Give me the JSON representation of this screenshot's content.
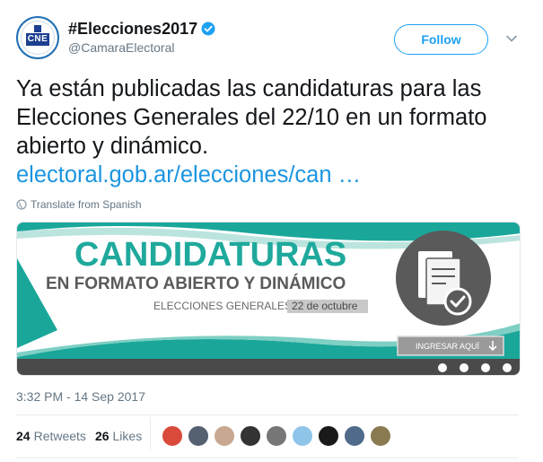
{
  "header": {
    "display_name": "#Elecciones2017",
    "handle": "@CamaraElectoral",
    "avatar_text": "CNE",
    "follow_label": "Follow"
  },
  "tweet": {
    "text": "Ya están publicadas las candidaturas para las Elecciones Generales del 22/10 en un formato abierto y dinámico.",
    "link": "electoral.gob.ar/elecciones/can …",
    "translate_label": "Translate from Spanish"
  },
  "card": {
    "title": "CANDIDATURAS",
    "subtitle": "EN FORMATO ABIERTO Y DINÁMICO",
    "elections_label": "ELECCIONES GENERALES",
    "date_label": "22 de octubre",
    "button_label": "INGRESAR AQUÍ",
    "colors": {
      "teal": "#1aa79a",
      "dark_bar": "#4a4a4a",
      "title_teal": "#1fa99c",
      "gray_text": "#5a5a5a"
    }
  },
  "timestamp": "3:32 PM - 14 Sep 2017",
  "stats": {
    "retweets_count": "24",
    "retweets_label": "Retweets",
    "likes_count": "26",
    "likes_label": "Likes"
  },
  "likers": [
    {
      "icon": "liker-avatar-1",
      "color": "#d94a3a"
    },
    {
      "icon": "liker-avatar-2",
      "color": "#556070"
    },
    {
      "icon": "liker-avatar-3",
      "color": "#c8a890"
    },
    {
      "icon": "liker-avatar-4",
      "color": "#333333"
    },
    {
      "icon": "liker-avatar-5",
      "color": "#777777"
    },
    {
      "icon": "liker-avatar-6",
      "color": "#8ec5e8"
    },
    {
      "icon": "liker-avatar-7",
      "color": "#1a1a1a"
    },
    {
      "icon": "liker-avatar-8",
      "color": "#4f6a8a"
    },
    {
      "icon": "liker-avatar-9",
      "color": "#8a7a52"
    }
  ],
  "accent": "#1da1f2"
}
